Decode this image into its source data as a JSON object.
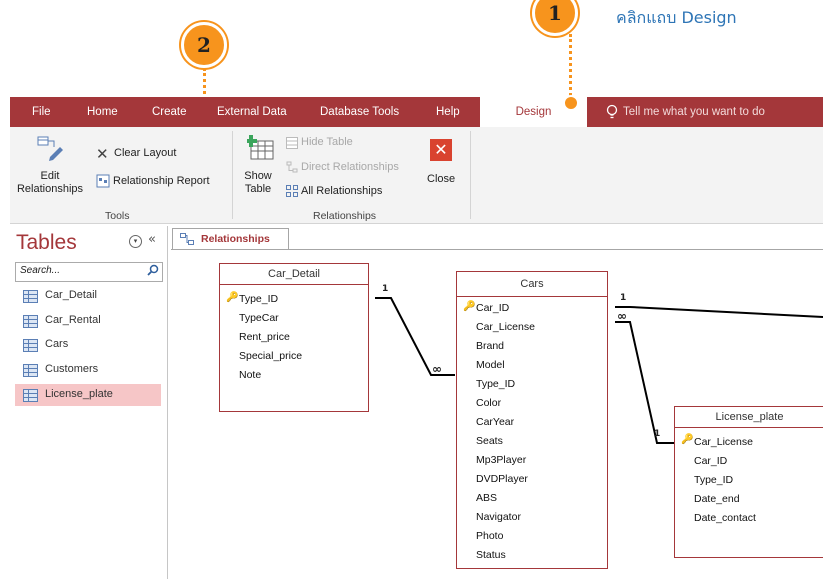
{
  "callouts": [
    {
      "number": "1",
      "text": "คลิกแถบ Design"
    },
    {
      "number": "2"
    }
  ],
  "menu": {
    "tabs": [
      "File",
      "Home",
      "Create",
      "External Data",
      "Database Tools",
      "Help",
      "Design"
    ],
    "active": "Design",
    "tell_me": "Tell me what you want to do"
  },
  "ribbon": {
    "tools": {
      "edit_relationships": "Edit Relationships",
      "clear_layout": "Clear Layout",
      "relationship_report": "Relationship Report",
      "group_label": "Tools"
    },
    "relationships": {
      "show_table": "Show Table",
      "hide_table": "Hide Table",
      "direct_relationships": "Direct Relationships",
      "all_relationships": "All Relationships",
      "close": "Close",
      "group_label": "Relationships"
    }
  },
  "nav": {
    "title": "Tables",
    "search_placeholder": "Search...",
    "items": [
      "Car_Detail",
      "Car_Rental",
      "Cars",
      "Customers",
      "License_plate"
    ],
    "selected": "License_plate"
  },
  "document_tab": "Relationships",
  "tables": {
    "car_detail": {
      "name": "Car_Detail",
      "key_field": "Type_ID",
      "fields": [
        "TypeCar",
        "Rent_price",
        "Special_price",
        "Note"
      ]
    },
    "cars": {
      "name": "Cars",
      "key_field": "Car_ID",
      "fields": [
        "Car_License",
        "Brand",
        "Model",
        "Type_ID",
        "Color",
        "CarYear",
        "Seats",
        "Mp3Player",
        "DVDPlayer",
        "ABS",
        "Navigator",
        "Photo",
        "Status"
      ]
    },
    "license_plate": {
      "name": "License_plate",
      "key_field": "Car_License",
      "fields": [
        "Car_ID",
        "Type_ID",
        "Date_end",
        "Date_contact"
      ]
    }
  },
  "relationship_labels": {
    "one": "1",
    "many": "∞"
  },
  "colors": {
    "accent": "#A4373A",
    "callout": "#F7941D",
    "callout_text": "#2E75B6",
    "selected": "#F6C6C7"
  }
}
